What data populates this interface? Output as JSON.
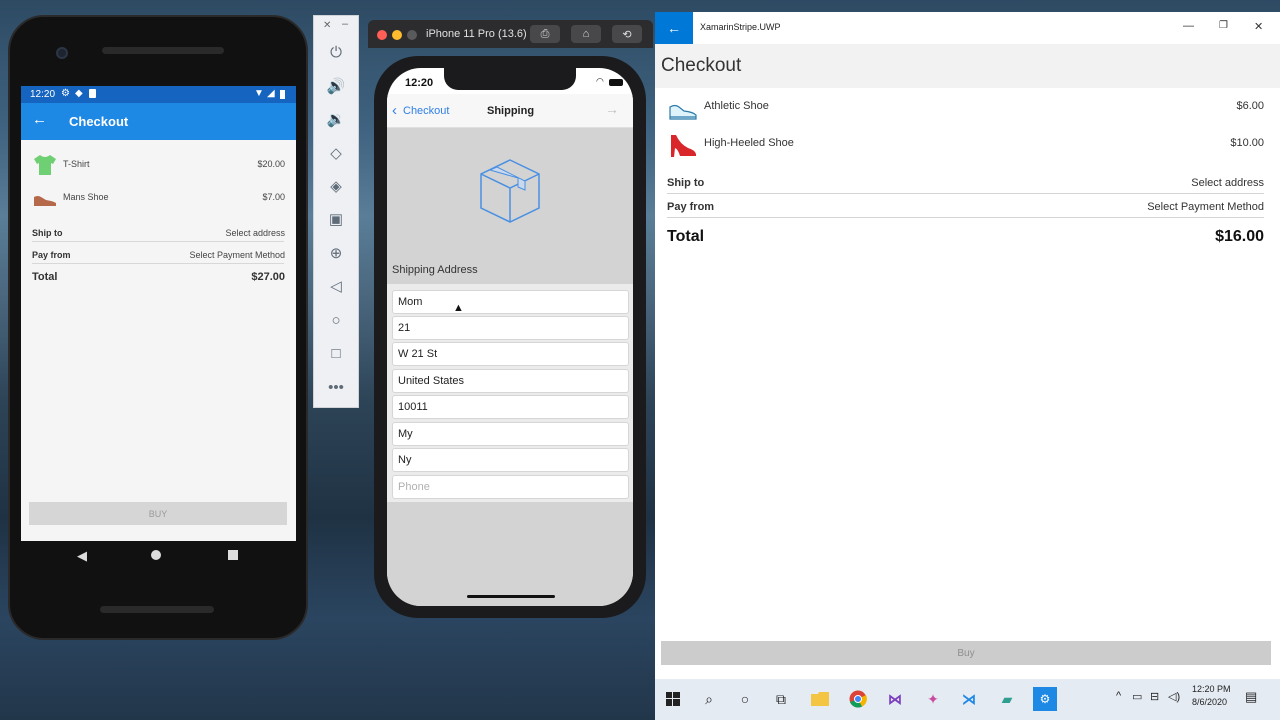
{
  "android": {
    "status_time": "12:20",
    "title": "Checkout",
    "items": [
      {
        "name": "T-Shirt",
        "price": "$20.00",
        "icon": "tshirt-icon"
      },
      {
        "name": "Mans Shoe",
        "price": "$7.00",
        "icon": "shoe-icon"
      }
    ],
    "ship_to_label": "Ship to",
    "ship_to_value": "Select address",
    "pay_from_label": "Pay from",
    "pay_from_value": "Select Payment Method",
    "total_label": "Total",
    "total_value": "$27.00",
    "buy_label": "BUY",
    "colors": {
      "accent": "#1e88e5",
      "status": "#1565c0"
    }
  },
  "ios": {
    "window_title": "iPhone 11 Pro (13.6)",
    "status_time": "12:20",
    "back_label": "Checkout",
    "nav_title": "Shipping",
    "section_header": "Shipping Address",
    "fields": [
      {
        "value": "Mom"
      },
      {
        "value": "21"
      },
      {
        "value": "W 21 St"
      },
      {
        "value": "United States"
      },
      {
        "value": "10011"
      },
      {
        "value": "My"
      },
      {
        "value": "Ny"
      }
    ],
    "phone_placeholder": "Phone",
    "colors": {
      "tint": "#2f7fe5",
      "box_icon": "#4a90e2"
    }
  },
  "uwp": {
    "window_title": "XamarinStripe.UWP",
    "page_title": "Checkout",
    "items": [
      {
        "name": "Athletic Shoe",
        "price": "$6.00",
        "icon": "athletic-shoe-icon"
      },
      {
        "name": "High-Heeled Shoe",
        "price": "$10.00",
        "icon": "high-heeled-shoe-icon"
      }
    ],
    "ship_to_label": "Ship to",
    "ship_to_value": "Select address",
    "pay_from_label": "Pay from",
    "pay_from_value": "Select Payment Method",
    "total_label": "Total",
    "total_value": "$16.00",
    "buy_label": "Buy",
    "colors": {
      "accent": "#0078d7"
    }
  },
  "taskbar": {
    "time": "12:20 PM",
    "date": "8/6/2020"
  }
}
